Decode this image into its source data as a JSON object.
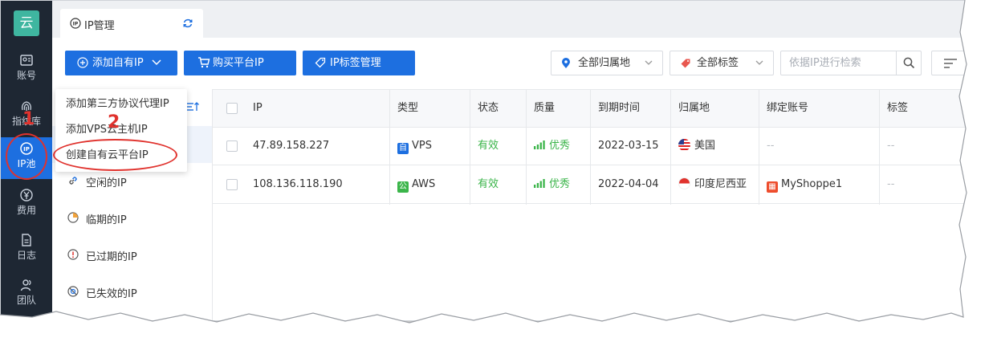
{
  "sidebar": {
    "logo": "云",
    "items": [
      {
        "label": "账号",
        "icon": "account-icon"
      },
      {
        "label": "指纹库",
        "icon": "fingerprint-icon"
      },
      {
        "label": "IP池",
        "icon": "ip-pool-icon"
      },
      {
        "label": "费用",
        "icon": "yen-icon"
      },
      {
        "label": "日志",
        "icon": "log-icon"
      },
      {
        "label": "团队",
        "icon": "team-icon"
      }
    ]
  },
  "tab": {
    "label": "IP管理",
    "icon": "ip-icon",
    "refresh_icon": "refresh-icon"
  },
  "toolbar": {
    "add_own_ip": "添加自有IP",
    "buy_platform_ip": "购买平台IP",
    "ip_tag_manage": "IP标签管理",
    "region_select": "全部归属地",
    "tag_select": "全部标签",
    "search_placeholder": "依据IP进行检索"
  },
  "dropdown": {
    "items": [
      "添加第三方协议代理IP",
      "添加VPS云主机IP",
      "创建自有云平台IP"
    ]
  },
  "filters": [
    {
      "label": "空闲的IP",
      "icon": "link-icon"
    },
    {
      "label": "临期的IP",
      "icon": "clock-icon"
    },
    {
      "label": "已过期的IP",
      "icon": "expired-icon"
    },
    {
      "label": "已失效的IP",
      "icon": "invalid-icon"
    }
  ],
  "table": {
    "columns": [
      "IP",
      "类型",
      "状态",
      "质量",
      "到期时间",
      "归属地",
      "绑定账号",
      "标签"
    ],
    "rows": [
      {
        "ip": "47.89.158.227",
        "type_badge": "自",
        "type": "VPS",
        "status": "有效",
        "quality": "优秀",
        "expiry": "2022-03-15",
        "region": "美国",
        "account": "--",
        "tag": "--"
      },
      {
        "ip": "108.136.118.190",
        "type_badge": "公",
        "type": "AWS",
        "status": "有效",
        "quality": "优秀",
        "expiry": "2022-04-04",
        "region": "印度尼西亚",
        "account": "MyShoppe1",
        "tag": "--"
      }
    ]
  },
  "annotations": {
    "step1": "1",
    "step2": "2"
  },
  "colors": {
    "primary": "#1d6fe0",
    "sidebar": "#1e2733",
    "success": "#3bb54a",
    "annotation": "#e0322d"
  }
}
